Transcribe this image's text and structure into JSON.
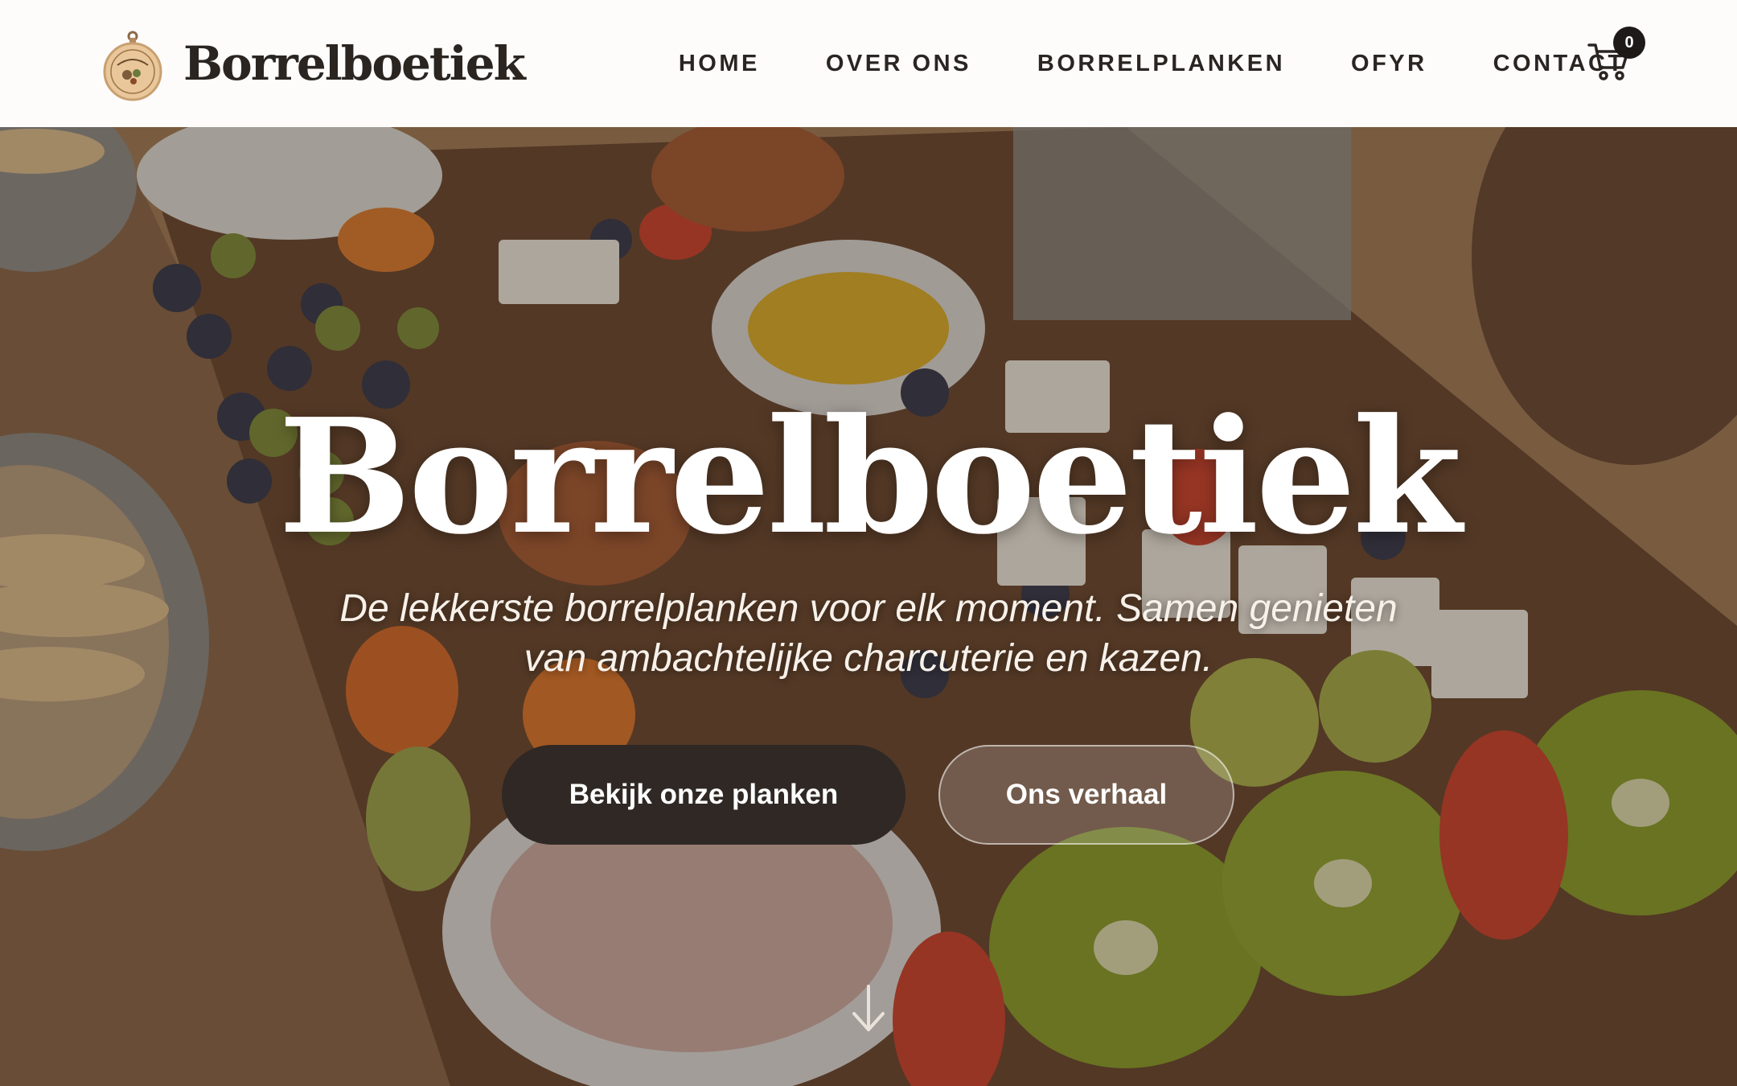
{
  "header": {
    "brand": "Borrelboetiek",
    "logo_icon": "borrelboetiek-badge-icon",
    "nav": [
      {
        "label": "HOME"
      },
      {
        "label": "OVER ONS"
      },
      {
        "label": "BORRELPLANKEN"
      },
      {
        "label": "OFYR"
      },
      {
        "label": "CONTACT"
      }
    ],
    "cart": {
      "icon": "cart-icon",
      "count": "0"
    }
  },
  "hero": {
    "title": "Borrelboetiek",
    "subtitle": "De lekkerste borrelplanken voor elk moment. Samen genieten van ambachtelijke charcuterie en kazen.",
    "primary_button": "Bekijk onze planken",
    "secondary_button": "Ons verhaal",
    "scroll_icon": "arrow-down-icon"
  },
  "colors": {
    "header_bg": "#fdfcfb",
    "text_dark": "#2a2521",
    "button_dark": "#2f2824",
    "hero_text": "#ffffff"
  }
}
